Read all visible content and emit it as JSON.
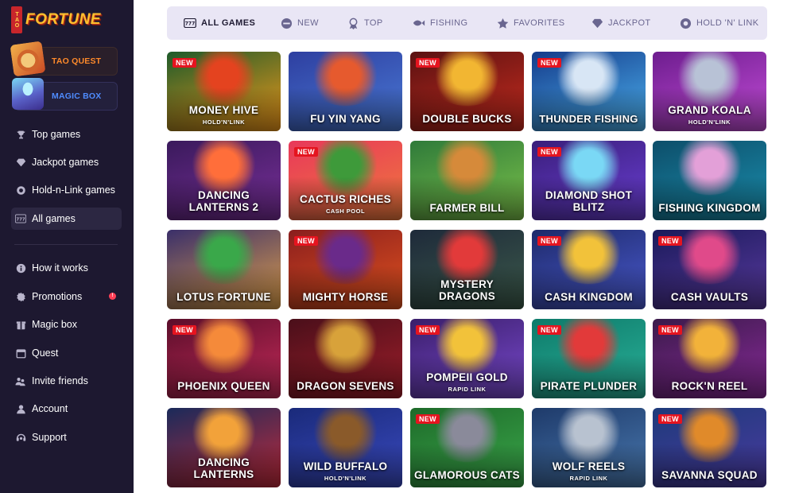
{
  "brand": {
    "logo_small": "TAO",
    "logo_word": "FORTUNE"
  },
  "promos": [
    {
      "label": "TAO QUEST"
    },
    {
      "label": "MAGIC BOX"
    }
  ],
  "nav_primary": [
    {
      "label": "Top games",
      "icon": "trophy-icon"
    },
    {
      "label": "Jackpot games",
      "icon": "diamond-icon"
    },
    {
      "label": "Hold-n-Link games",
      "icon": "coin-icon"
    },
    {
      "label": "All games",
      "icon": "slot-777-icon",
      "active": true
    }
  ],
  "nav_secondary": [
    {
      "label": "How it works",
      "icon": "info-icon"
    },
    {
      "label": "Promotions",
      "icon": "gear-badge-icon",
      "badge": "!"
    },
    {
      "label": "Magic box",
      "icon": "gift-box-icon"
    },
    {
      "label": "Quest",
      "icon": "calendar-icon"
    },
    {
      "label": "Invite friends",
      "icon": "people-icon"
    },
    {
      "label": "Account",
      "icon": "user-icon"
    },
    {
      "label": "Support",
      "icon": "headset-icon"
    }
  ],
  "tabs": [
    {
      "label": "ALL GAMES",
      "icon": "slot-777-icon",
      "active": true
    },
    {
      "label": "NEW",
      "icon": "new-icon"
    },
    {
      "label": "TOP",
      "icon": "trophy-icon"
    },
    {
      "label": "FISHING",
      "icon": "fish-icon"
    },
    {
      "label": "FAVORITES",
      "icon": "star-icon"
    },
    {
      "label": "JACKPOT",
      "icon": "diamond-icon"
    },
    {
      "label": "HOLD 'N' LINK",
      "icon": "coin-icon"
    }
  ],
  "new_label": "NEW",
  "games": [
    {
      "title": "MONEY HIVE",
      "sub": "HOLD'N'LINK",
      "new": true,
      "colors": [
        "#1d5a2a",
        "#f39a1a",
        "#e4431f"
      ]
    },
    {
      "title": "FU YIN YANG",
      "sub": "",
      "new": false,
      "colors": [
        "#2e3fa0",
        "#4a7ad6",
        "#e65a2e"
      ]
    },
    {
      "title": "DOUBLE BUCKS",
      "sub": "",
      "new": true,
      "colors": [
        "#5a1212",
        "#c92b1e",
        "#f2b632"
      ]
    },
    {
      "title": "THUNDER FISHING",
      "sub": "",
      "new": true,
      "colors": [
        "#153b8a",
        "#4cb3f0",
        "#d8e6f5"
      ]
    },
    {
      "title": "GRAND KOALA",
      "sub": "HOLD'N'LINK",
      "new": false,
      "colors": [
        "#6d1d8e",
        "#c54dd9",
        "#b8c2d6"
      ]
    },
    {
      "title": "DANCING LANTERNS 2",
      "sub": "",
      "new": false,
      "colors": [
        "#3a1a5c",
        "#7a2f9a",
        "#ff6e3a"
      ]
    },
    {
      "title": "CACTUS RICHES",
      "sub": "CASH POOL",
      "new": true,
      "colors": [
        "#e8385a",
        "#f07a3c",
        "#3e9a3a"
      ]
    },
    {
      "title": "FARMER BILL",
      "sub": "",
      "new": false,
      "colors": [
        "#2f7a3a",
        "#7cc34a",
        "#d68a3a"
      ]
    },
    {
      "title": "DIAMOND SHOT BLITZ",
      "sub": "",
      "new": true,
      "colors": [
        "#3a1e7a",
        "#6b3fd6",
        "#7ad8f5"
      ]
    },
    {
      "title": "FISHING KINGDOM",
      "sub": "",
      "new": false,
      "colors": [
        "#0d4e6a",
        "#1a8fae",
        "#e3a0d8"
      ]
    },
    {
      "title": "LOTUS FORTUNE",
      "sub": "",
      "new": false,
      "colors": [
        "#3a2f6a",
        "#e0a04a",
        "#3aa84a"
      ]
    },
    {
      "title": "MIGHTY HORSE",
      "sub": "",
      "new": true,
      "colors": [
        "#8a1e1e",
        "#e0521e",
        "#6a2a8a"
      ]
    },
    {
      "title": "MYSTERY DRAGONS",
      "sub": "",
      "new": false,
      "colors": [
        "#1e2a3a",
        "#3c5a4a",
        "#e23a3a"
      ]
    },
    {
      "title": "CASH KINGDOM",
      "sub": "",
      "new": true,
      "colors": [
        "#1e2a6a",
        "#4a5ad0",
        "#f2c23a"
      ]
    },
    {
      "title": "CASH VAULTS",
      "sub": "",
      "new": true,
      "colors": [
        "#1a1a5a",
        "#5a3aa0",
        "#e04a8a"
      ]
    },
    {
      "title": "PHOENIX QUEEN",
      "sub": "",
      "new": true,
      "colors": [
        "#5a0e2a",
        "#c72a5a",
        "#f58a3a"
      ]
    },
    {
      "title": "DRAGON SEVENS",
      "sub": "",
      "new": false,
      "colors": [
        "#4a0f1a",
        "#a01e2a",
        "#d8a23a"
      ]
    },
    {
      "title": "POMPEII GOLD",
      "sub": "RAPID LINK",
      "new": true,
      "colors": [
        "#3a1e6a",
        "#7a4ad0",
        "#f2c23a"
      ]
    },
    {
      "title": "PIRATE PLUNDER",
      "sub": "",
      "new": true,
      "colors": [
        "#0e7a6a",
        "#2ab39a",
        "#e23a3a"
      ]
    },
    {
      "title": "ROCK'N REEL",
      "sub": "",
      "new": true,
      "colors": [
        "#3a1a4a",
        "#8a2a9a",
        "#f2b23a"
      ]
    },
    {
      "title": "DANCING LANTERNS",
      "sub": "",
      "new": false,
      "colors": [
        "#1a2a5a",
        "#c22a3a",
        "#f2a23a"
      ]
    },
    {
      "title": "WILD BUFFALO",
      "sub": "HOLD'N'LINK",
      "new": false,
      "colors": [
        "#1a2a7a",
        "#3a4ac0",
        "#8a5a2a"
      ]
    },
    {
      "title": "GLAMOROUS CATS",
      "sub": "",
      "new": true,
      "colors": [
        "#1e6a2a",
        "#3aa84a",
        "#8a8a9a"
      ]
    },
    {
      "title": "WOLF REELS",
      "sub": "RAPID LINK",
      "new": false,
      "colors": [
        "#1e3a6a",
        "#4a7ab0",
        "#b8c2d0"
      ]
    },
    {
      "title": "SAVANNA SQUAD",
      "sub": "",
      "new": true,
      "colors": [
        "#1e3a7a",
        "#4a3aa0",
        "#e08a2a"
      ]
    }
  ]
}
